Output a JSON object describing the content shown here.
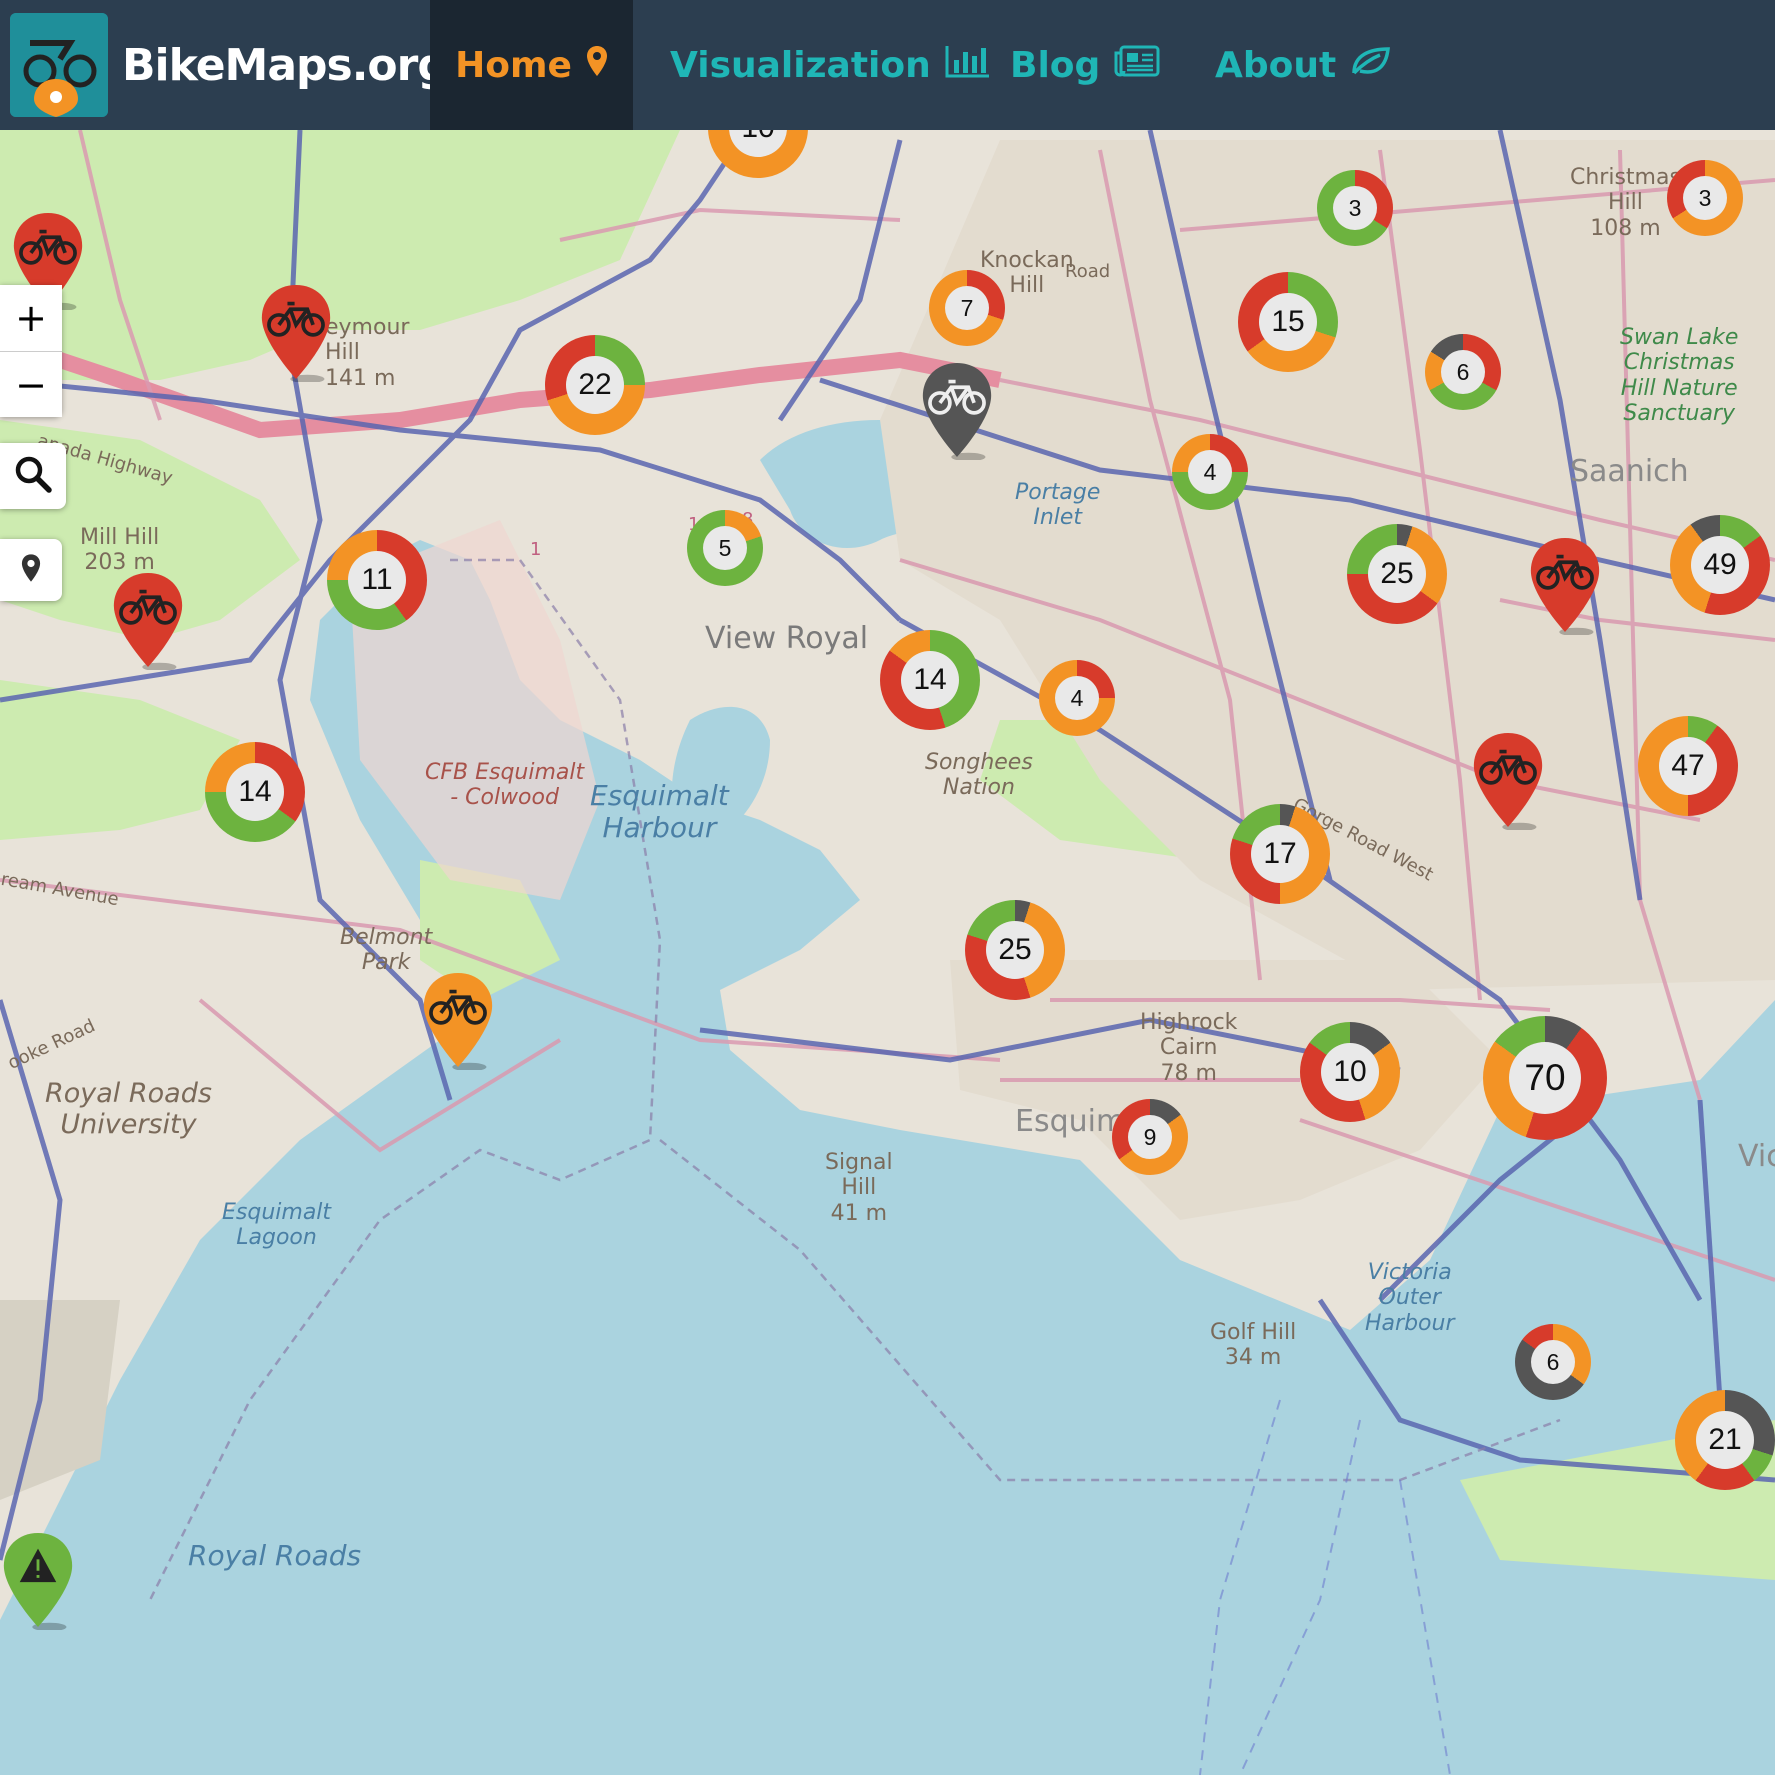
{
  "brand": {
    "name": "BikeMaps.org"
  },
  "nav": [
    {
      "label": "Home",
      "icon": "map-marker-icon",
      "active": true
    },
    {
      "label": "Visualization",
      "icon": "bar-chart-icon",
      "active": false
    },
    {
      "label": "Blog",
      "icon": "newspaper-icon",
      "active": false
    },
    {
      "label": "About",
      "icon": "leaf-icon",
      "active": false
    }
  ],
  "controls": {
    "zoom_in": "+",
    "zoom_out": "−"
  },
  "colors": {
    "red": "#d73b2b",
    "orange": "#f39325",
    "green": "#6db33f",
    "grey": "#555555",
    "nav_bg": "#2c3e50",
    "nav_active_text": "#f39325",
    "nav_text": "#1fb6b6"
  },
  "labels": {
    "knockan": "Knockan\nHill",
    "seymour": "eymour\nHill\n141 m",
    "mill": "Mill Hill\n203 m",
    "christmas": "Christmas\nHill\n108 m",
    "swan": "Swan Lake\nChristmas\nHill Nature\nSanctuary",
    "saanich": "Saanich",
    "portage": "Portage\nInlet",
    "viewroyal": "View Royal",
    "songhees": "Songhees\nNation",
    "cfb": "CFB Esquimalt\n- Colwood",
    "harbour": "Esquimalt\nHarbour",
    "belmont": "Belmont\nPark",
    "royalroadsu": "Royal Roads\nUniversity",
    "lagoon": "Esquimalt\nLagoon",
    "signal": "Signal\nHill\n41 m",
    "highrock": "Highrock\nCairn\n78 m",
    "esquimalt": "Esquim",
    "golf": "Golf Hill\n34 m",
    "outer": "Victoria\nOuter\nHarbour",
    "royalroads": "Royal Roads",
    "vic": "Vic",
    "gorge": "Gorge Road West",
    "road": "Road",
    "trans": "anada Highway",
    "cook": "ooke Road",
    "treanor": "ream Avenue",
    "route1": "1",
    "route10": "10",
    "route8": "8"
  },
  "clusters": [
    {
      "count": "10",
      "mix": {
        "orange": 0.8,
        "red": 0.1,
        "green": 0.1
      }
    },
    {
      "count": "3",
      "mix": {
        "red": 0.34,
        "green": 0.66
      }
    },
    {
      "count": "3",
      "mix": {
        "orange": 0.66,
        "red": 0.34
      }
    },
    {
      "count": "7",
      "mix": {
        "red": 0.3,
        "orange": 0.7
      }
    },
    {
      "count": "15",
      "mix": {
        "green": 0.3,
        "orange": 0.35,
        "red": 0.35
      }
    },
    {
      "count": "6",
      "mix": {
        "red": 0.33,
        "green": 0.34,
        "orange": 0.17,
        "grey": 0.16
      }
    },
    {
      "count": "22",
      "mix": {
        "green": 0.25,
        "orange": 0.45,
        "red": 0.3
      }
    },
    {
      "count": "4",
      "mix": {
        "red": 0.25,
        "green": 0.5,
        "orange": 0.25
      }
    },
    {
      "count": "5",
      "mix": {
        "orange": 0.2,
        "green": 0.8
      }
    },
    {
      "count": "25",
      "mix": {
        "grey": 0.05,
        "orange": 0.3,
        "red": 0.4,
        "green": 0.25
      }
    },
    {
      "count": "49",
      "mix": {
        "green": 0.15,
        "red": 0.4,
        "orange": 0.35,
        "grey": 0.1
      }
    },
    {
      "count": "11",
      "mix": {
        "red": 0.4,
        "green": 0.35,
        "orange": 0.25
      }
    },
    {
      "count": "14",
      "mix": {
        "green": 0.45,
        "red": 0.4,
        "orange": 0.15
      }
    },
    {
      "count": "4",
      "mix": {
        "red": 0.25,
        "orange": 0.75
      }
    },
    {
      "count": "14",
      "mix": {
        "red": 0.35,
        "green": 0.4,
        "orange": 0.25
      }
    },
    {
      "count": "47",
      "mix": {
        "green": 0.1,
        "red": 0.4,
        "orange": 0.5
      }
    },
    {
      "count": "17",
      "mix": {
        "grey": 0.05,
        "orange": 0.45,
        "red": 0.3,
        "green": 0.2
      }
    },
    {
      "count": "25",
      "mix": {
        "grey": 0.05,
        "orange": 0.4,
        "red": 0.35,
        "green": 0.2
      }
    },
    {
      "count": "10",
      "mix": {
        "grey": 0.15,
        "orange": 0.3,
        "red": 0.4,
        "green": 0.15
      }
    },
    {
      "count": "70",
      "mix": {
        "grey": 0.1,
        "red": 0.45,
        "orange": 0.3,
        "green": 0.15
      }
    },
    {
      "count": "9",
      "mix": {
        "grey": 0.15,
        "orange": 0.5,
        "red": 0.35
      }
    },
    {
      "count": "6",
      "mix": {
        "orange": 0.35,
        "grey": 0.5,
        "red": 0.15
      }
    },
    {
      "count": "21",
      "mix": {
        "grey": 0.3,
        "green": 0.1,
        "red": 0.2,
        "orange": 0.4
      }
    }
  ],
  "pins": [
    {
      "color": "red",
      "icon": "bicycle-icon"
    },
    {
      "color": "red",
      "icon": "bicycle-icon"
    },
    {
      "color": "red",
      "icon": "bicycle-icon"
    },
    {
      "color": "grey",
      "icon": "bicycle-icon"
    },
    {
      "color": "red",
      "icon": "bicycle-icon"
    },
    {
      "color": "red",
      "icon": "bicycle-icon"
    },
    {
      "color": "orange",
      "icon": "bicycle-icon"
    },
    {
      "color": "green",
      "icon": "hazard-icon"
    }
  ]
}
